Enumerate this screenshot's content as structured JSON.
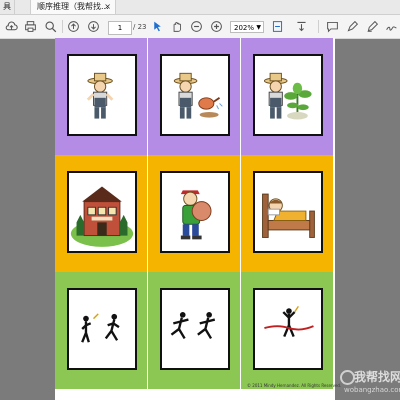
{
  "tabbar": {
    "left_label": "具",
    "doc_title": "顺序推理（我帮找...",
    "close_symbol": "×"
  },
  "toolbar": {
    "page_current": "1",
    "page_total": "/ 23",
    "zoom": "202%"
  },
  "rows": [
    {
      "color": "#b48ce6",
      "cards": [
        "farmer-standing",
        "farmer-watering-seed",
        "farmer-with-plant"
      ]
    },
    {
      "color": "#f4b400",
      "cards": [
        "house",
        "boy-carrying-ball",
        "boy-in-bed"
      ]
    },
    {
      "color": "#8cc653",
      "cards": [
        "runners-starting",
        "runners-racing",
        "runner-finishing"
      ]
    }
  ],
  "copyright": "© 2011 Mindy Hernandez. All Rights Reserved.",
  "watermark": {
    "text": "我帮找网",
    "sub": "wobangzhao.com"
  }
}
